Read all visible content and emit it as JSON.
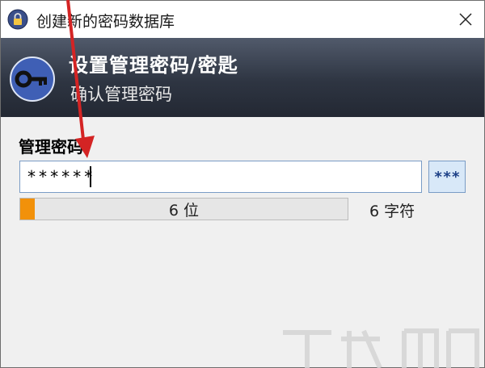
{
  "window": {
    "title": "创建新的密码数据库"
  },
  "banner": {
    "title": "设置管理密码/密匙",
    "subtitle": "确认管理密码"
  },
  "form": {
    "label": "管理密码：",
    "password_value": "******",
    "reveal_label": "***",
    "quality_text": "6 位",
    "quality_fraction": 0.045,
    "char_count": "6 字符"
  },
  "icons": {
    "title": "lock-icon",
    "banner": "key-icon",
    "close": "close-icon"
  },
  "colors": {
    "banner_dark": "#2e3542",
    "quality_fill": "#f2910a",
    "annotation_arrow": "#d42424"
  }
}
